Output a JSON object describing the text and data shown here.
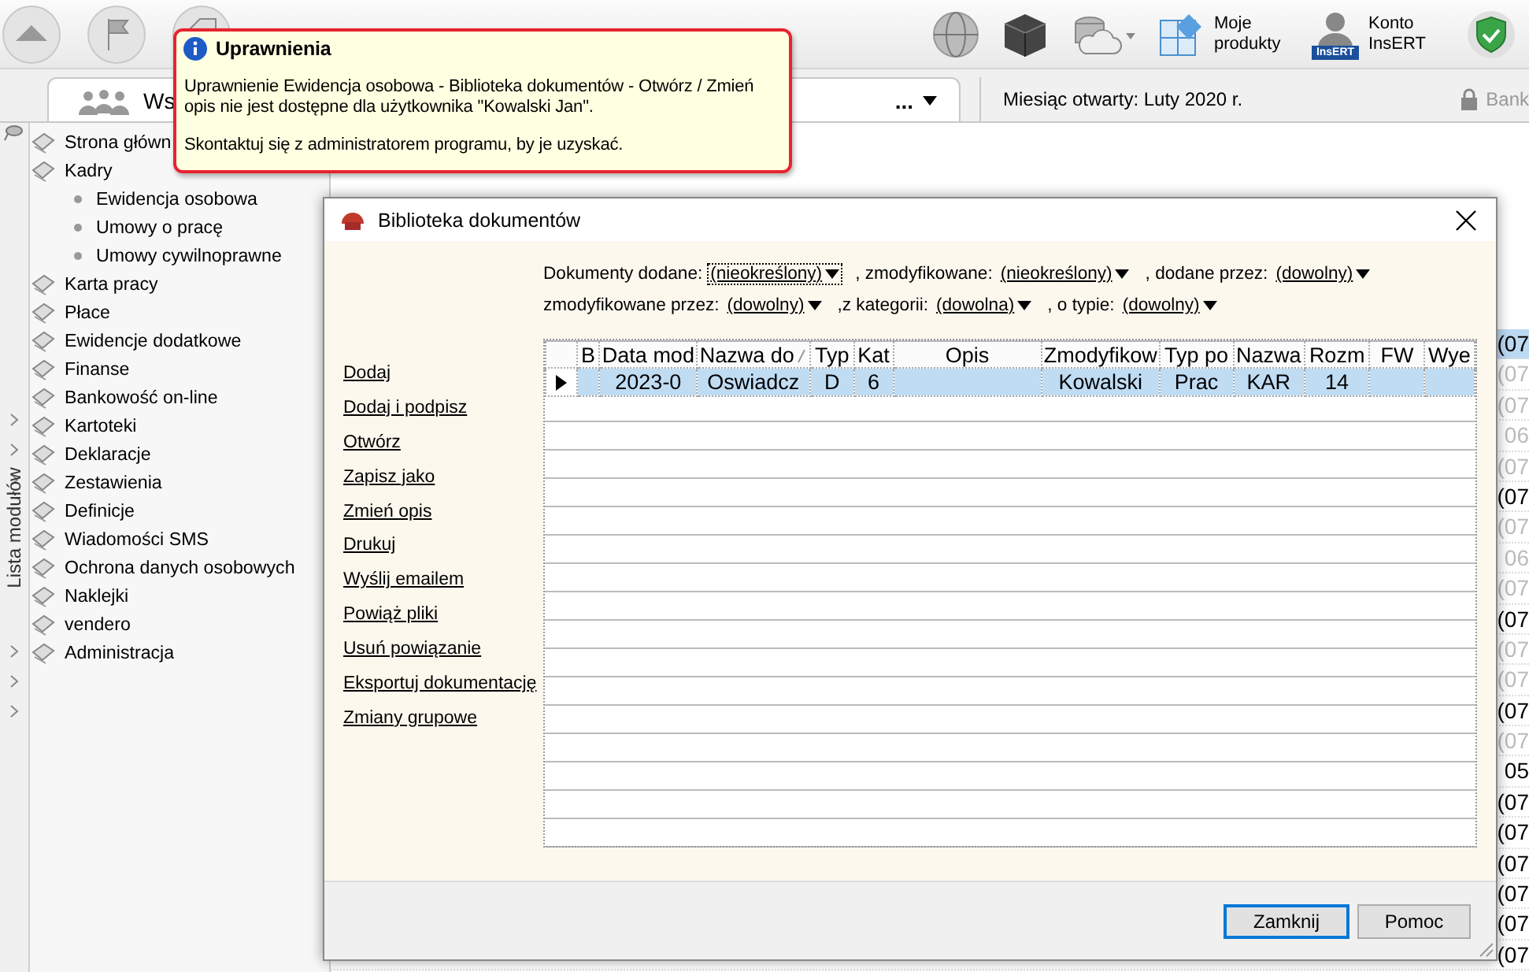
{
  "toolbar": {
    "products": "Moje produkty",
    "account": "Konto InsERT",
    "account_badge": "InsERT"
  },
  "tabbar": {
    "tab": "Ws",
    "menu": "...",
    "month": "Miesiąc otwarty:  Luty 2020 r.",
    "bank": "Bank",
    "bank_disabled": true
  },
  "side_strip": {
    "label": "Lista modułów"
  },
  "sidebar": {
    "items": [
      {
        "label": "Strona główn"
      },
      {
        "label": "Kadry",
        "children": [
          {
            "label": "Ewidencja osobowa"
          },
          {
            "label": "Umowy o pracę"
          },
          {
            "label": "Umowy cywilnoprawne"
          }
        ]
      },
      {
        "label": "Karta pracy"
      },
      {
        "label": "Płace"
      },
      {
        "label": "Ewidencje dodatkowe"
      },
      {
        "label": "Finanse"
      },
      {
        "label": "Bankowość on-line"
      },
      {
        "label": "Kartoteki"
      },
      {
        "label": "Deklaracje"
      },
      {
        "label": "Zestawienia"
      },
      {
        "label": "Definicje"
      },
      {
        "label": "Wiadomości SMS"
      },
      {
        "label": "Ochrona danych osobowych"
      },
      {
        "label": "Naklejki"
      },
      {
        "label": "vendero"
      },
      {
        "label": "Administracja"
      }
    ]
  },
  "background_list": [
    {
      "text": "(07",
      "dim": false,
      "selected": true
    },
    {
      "text": "(07",
      "dim": true,
      "selected": false
    },
    {
      "text": "(07",
      "dim": true,
      "selected": false
    },
    {
      "text": "06",
      "dim": true,
      "selected": false
    },
    {
      "text": "(07",
      "dim": true,
      "selected": false
    },
    {
      "text": "(07",
      "dim": false,
      "selected": false
    },
    {
      "text": "(07",
      "dim": true,
      "selected": false
    },
    {
      "text": "06",
      "dim": true,
      "selected": false
    },
    {
      "text": "(07",
      "dim": true,
      "selected": false
    },
    {
      "text": "(07",
      "dim": false,
      "selected": false
    },
    {
      "text": "(07",
      "dim": true,
      "selected": false
    },
    {
      "text": "(07",
      "dim": true,
      "selected": false
    },
    {
      "text": "(07",
      "dim": false,
      "selected": false
    },
    {
      "text": "(07",
      "dim": true,
      "selected": false
    },
    {
      "text": "05",
      "dim": false,
      "selected": false
    },
    {
      "text": "(07",
      "dim": false,
      "selected": false
    },
    {
      "text": "(07",
      "dim": false,
      "selected": false
    },
    {
      "text": "(07",
      "dim": false,
      "selected": false
    },
    {
      "text": "(07",
      "dim": false,
      "selected": false
    },
    {
      "text": "(07",
      "dim": false,
      "selected": false
    },
    {
      "text": "(07",
      "dim": false,
      "selected": false
    }
  ],
  "tooltip": {
    "title": "Uprawnienia",
    "message": "Uprawnienie Ewidencja osobowa - Biblioteka dokumentów - Otwórz / Zmień opis nie jest dostępne dla użytkownika \"Kowalski Jan\".",
    "hint": "Skontaktuj się z administratorem programu, by je uzyskać."
  },
  "dialog": {
    "title": "Biblioteka dokumentów",
    "filters": [
      {
        "label": "Dokumenty dodane:",
        "value": "(nieokreślony)",
        "focused": true
      },
      {
        "label": ", zmodyfikowane:",
        "value": "(nieokreślony)",
        "focused": false
      },
      {
        "label": ", dodane przez:",
        "value": "(dowolny)",
        "focused": false
      },
      {
        "label": "zmodyfikowane przez:",
        "value": "(dowolny)",
        "focused": false
      },
      {
        "label": ",z kategorii:",
        "value": "(dowolna)",
        "focused": false
      },
      {
        "label": ", o typie:",
        "value": "(dowolny)",
        "focused": false
      }
    ],
    "actions": [
      "Dodaj",
      "Dodaj i podpisz",
      "Otwórz",
      "Zapisz jako",
      "Zmień opis",
      "Drukuj",
      "Wyślij emailem",
      "Powiąż pliki",
      "Usuń powiązanie",
      "Eksportuj dokumentację",
      "Zmiany grupowe"
    ],
    "table": {
      "columns": [
        {
          "label": "B",
          "sorted": false
        },
        {
          "label": "Data mod",
          "sorted": false
        },
        {
          "label": "Nazwa do",
          "sorted": true
        },
        {
          "label": "Typ",
          "sorted": false
        },
        {
          "label": "Kat",
          "sorted": false
        },
        {
          "label": "Opis",
          "sorted": false
        },
        {
          "label": "Zmodyfikow",
          "sorted": false
        },
        {
          "label": "Typ po",
          "sorted": false
        },
        {
          "label": "Nazwa",
          "sorted": false
        },
        {
          "label": "Rozm",
          "sorted": false
        },
        {
          "label": "FW",
          "sorted": false
        },
        {
          "label": "Wye",
          "sorted": false
        }
      ],
      "rows": [
        {
          "selected": true,
          "cells": [
            "",
            "2023-0",
            "Oswiadcz",
            "D",
            "6",
            "",
            "Kowalski",
            "Prac",
            "KAR",
            "14",
            "",
            ""
          ]
        }
      ]
    },
    "buttons": [
      {
        "label": "Zamknij",
        "default": true
      },
      {
        "label": "Pomoc",
        "default": false
      }
    ]
  }
}
